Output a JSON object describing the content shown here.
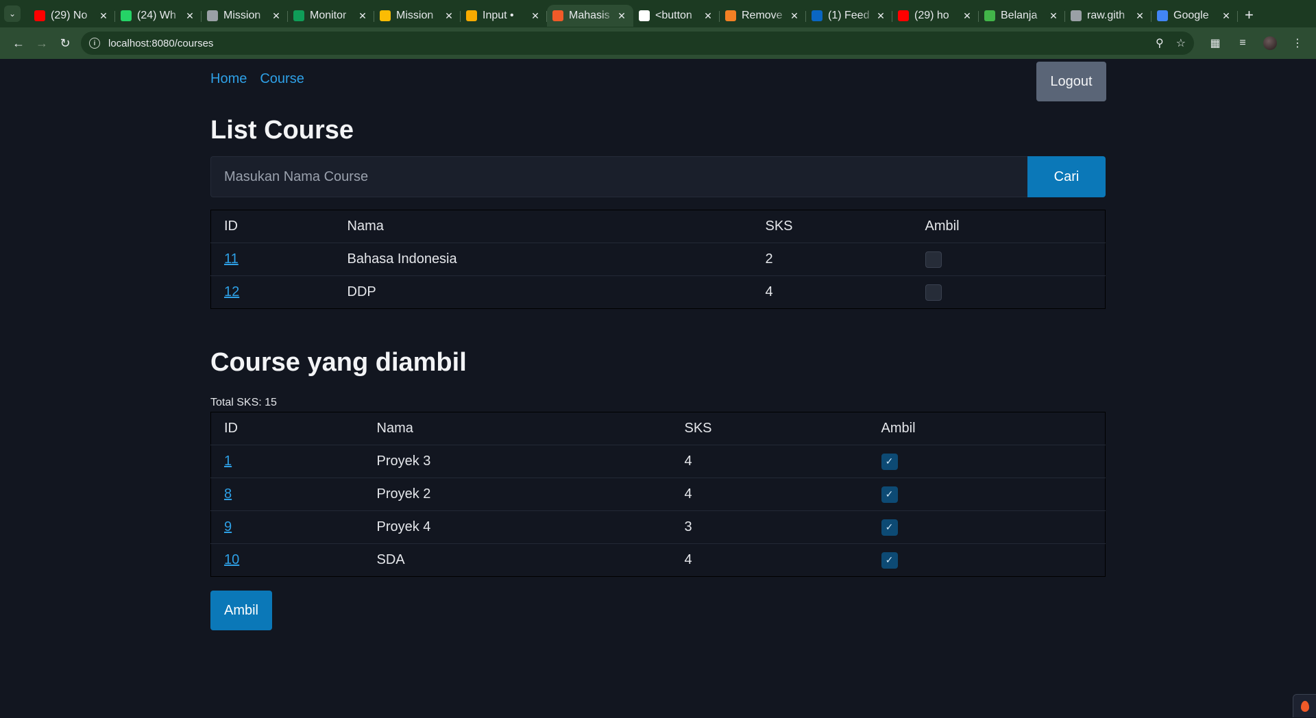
{
  "browser": {
    "tabs": [
      {
        "title": "(29) No",
        "favicon": "youtube-icon",
        "color": "#ff0000",
        "active": false
      },
      {
        "title": "(24) Wh",
        "favicon": "whatsapp-icon",
        "color": "#25d366",
        "active": false
      },
      {
        "title": "Mission",
        "favicon": "image-icon",
        "color": "#9aa0a6",
        "active": false
      },
      {
        "title": "Monitor",
        "favicon": "sheets-icon",
        "color": "#0f9d58",
        "active": false
      },
      {
        "title": "Mission",
        "favicon": "drive-icon",
        "color": "#fbbc04",
        "active": false
      },
      {
        "title": "Input •",
        "favicon": "sparkle-icon",
        "color": "#f9ab00",
        "active": false
      },
      {
        "title": "Mahasis",
        "favicon": "flame-icon",
        "color": "#f05a28",
        "active": true
      },
      {
        "title": "<button",
        "favicon": "medium-icon",
        "color": "#ffffff",
        "active": false
      },
      {
        "title": "Remove",
        "favicon": "stackoverflow-icon",
        "color": "#f48024",
        "active": false
      },
      {
        "title": "(1) Feed",
        "favicon": "linkedin-icon",
        "color": "#0a66c2",
        "active": false
      },
      {
        "title": "(29) ho",
        "favicon": "youtube-icon",
        "color": "#ff0000",
        "active": false
      },
      {
        "title": "Belanja",
        "favicon": "tokopedia-icon",
        "color": "#42b549",
        "active": false
      },
      {
        "title": "raw.gith",
        "favicon": "globe-icon",
        "color": "#9aa0a6",
        "active": false
      },
      {
        "title": "Google",
        "favicon": "gemini-icon",
        "color": "#4285f4",
        "active": false
      }
    ],
    "url": "localhost:8080/courses"
  },
  "nav": {
    "home": "Home",
    "course": "Course",
    "logout": "Logout"
  },
  "list_course": {
    "title": "List Course",
    "search_placeholder": "Masukan Nama Course",
    "search_button": "Cari",
    "headers": [
      "ID",
      "Nama",
      "SKS",
      "Ambil"
    ],
    "rows": [
      {
        "id": "11",
        "nama": "Bahasa Indonesia",
        "sks": "2",
        "ambil": false
      },
      {
        "id": "12",
        "nama": "DDP",
        "sks": "4",
        "ambil": false
      }
    ]
  },
  "taken_course": {
    "title": "Course yang diambil",
    "total_sks": "Total SKS: 15",
    "headers": [
      "ID",
      "Nama",
      "SKS",
      "Ambil"
    ],
    "rows": [
      {
        "id": "1",
        "nama": "Proyek 3",
        "sks": "4",
        "ambil": true
      },
      {
        "id": "8",
        "nama": "Proyek 2",
        "sks": "4",
        "ambil": true
      },
      {
        "id": "9",
        "nama": "Proyek 4",
        "sks": "3",
        "ambil": true
      },
      {
        "id": "10",
        "nama": "SDA",
        "sks": "4",
        "ambil": true
      }
    ],
    "submit_button": "Ambil"
  }
}
